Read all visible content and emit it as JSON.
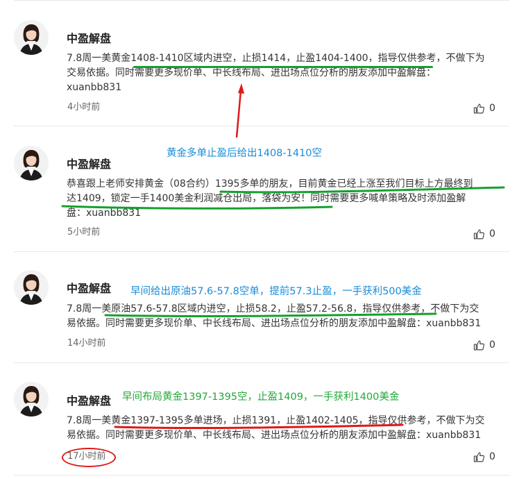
{
  "colors": {
    "text": "#333333",
    "author": "#222222",
    "time": "#666666",
    "divider": "#e8e8e8",
    "annotation_blue": "#1a8cd8",
    "annotation_green": "#22a83a",
    "underline_green": "#14a02e",
    "underline_red": "#e01818"
  },
  "posts": [
    {
      "author": "中盈解盘",
      "avatar_icon": "avatar-woman-icon",
      "content_line1": "7.8周一美黄金1408-1410区域内进空，止损1414，止盈1404-1400，指导仅供参考，不做下为",
      "content_line2": "交易依据。同时需要更多现价单、中长线布局、进出场点位分析的朋友添加中盈解盘：",
      "content_line3": "xuanbb831",
      "time": "4小时前",
      "likes": "0"
    },
    {
      "author": "中盈解盘",
      "avatar_icon": "avatar-woman-icon",
      "content_line1": "恭喜跟上老师安排黄金（08合约）1395多单的朋友，目前黄金已经上涨至我们目标上方最终到",
      "content_line2": "达1409，锁定一手1400美金利润减仓出局，落袋为安！同时需要更多喊单策略及时添加盈解",
      "content_line3": "盘：xuanbb831",
      "time": "5小时前",
      "likes": "0"
    },
    {
      "author": "中盈解盘",
      "avatar_icon": "avatar-woman-icon",
      "content_line1": "7.8周一美原油57.6-57.8区域内进空，止损58.2，止盈57.2-56.8，指导仅供参考，不做下为交",
      "content_line2": "易依据。同时需要更多现价单、中长线布局、进出场点位分析的朋友添加中盈解盘：xuanbb831",
      "time": "14小时前",
      "likes": "0"
    },
    {
      "author": "中盈解盘",
      "avatar_icon": "avatar-woman-icon",
      "content_line1": "7.8周一美黄金1397-1395多单进场，止损1391，止盈1402-1405，指导仅供参考，不做下为交",
      "content_line2": "易依据。同时需要更多现价单、中长线布局、进出场点位分析的朋友添加中盈解盘：xuanbb831",
      "time": "17小时前",
      "likes": "0"
    }
  ],
  "annotations": {
    "gold_short_note": "黄金多单止盈后给出1408-1410空",
    "oil_short_note": "早间给出原油57.6-57.8空单，提前57.3止盈，一手获利500美金",
    "gold_layout_note": "早间布局黄金1397-1395空，止盈1409，一手获利1400美金"
  }
}
